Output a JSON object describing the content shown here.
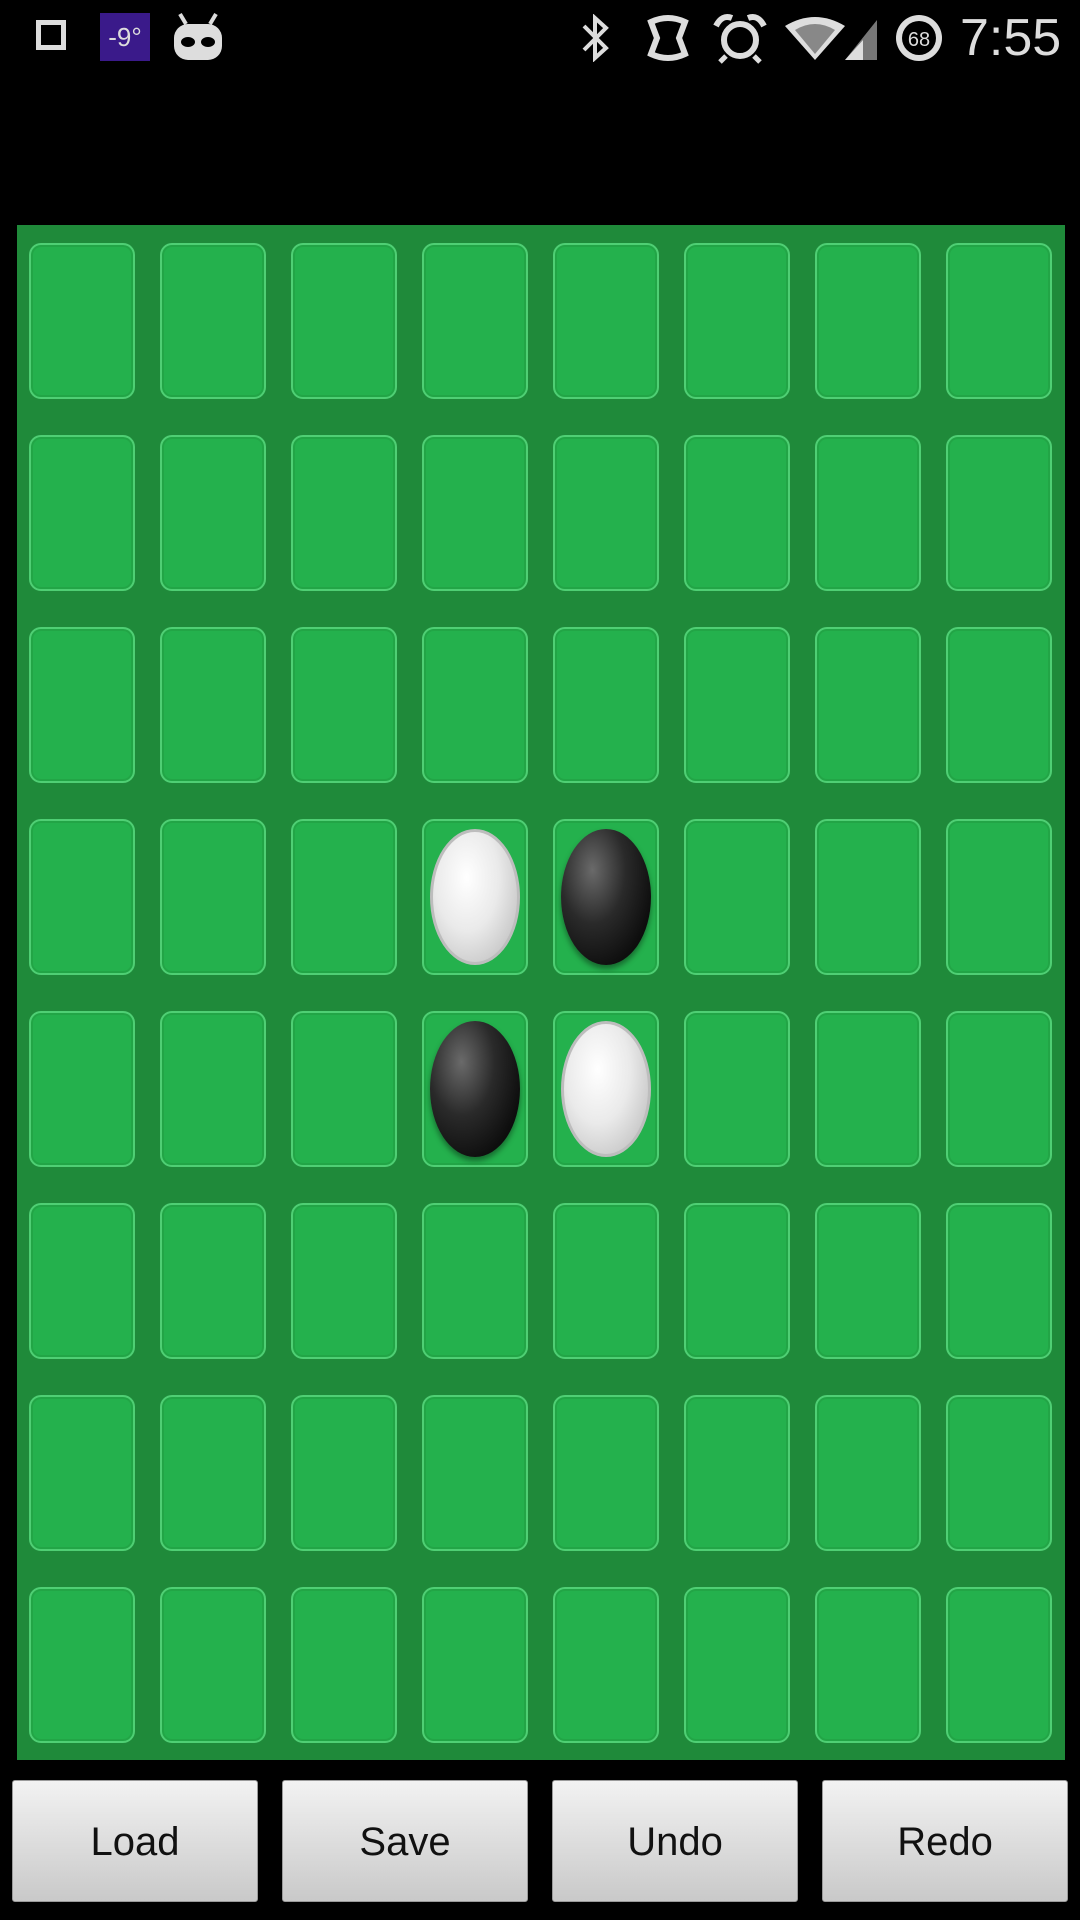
{
  "status_bar": {
    "temperature": "-9°",
    "battery_level": "68",
    "time": "7:55",
    "icons": [
      "square-notification-icon",
      "android-bot-icon",
      "bluetooth-icon",
      "nfc-icon",
      "alarm-icon",
      "wifi-icon",
      "signal-icon",
      "battery-icon"
    ]
  },
  "board": {
    "rows": 8,
    "cols": 8,
    "colors": {
      "board": "#1f8a3a",
      "tile": "#24b14d"
    },
    "pieces": [
      {
        "row": 3,
        "col": 3,
        "color": "white"
      },
      {
        "row": 3,
        "col": 4,
        "color": "black"
      },
      {
        "row": 4,
        "col": 3,
        "color": "black"
      },
      {
        "row": 4,
        "col": 4,
        "color": "white"
      }
    ]
  },
  "buttons": {
    "load": "Load",
    "save": "Save",
    "undo": "Undo",
    "redo": "Redo"
  }
}
